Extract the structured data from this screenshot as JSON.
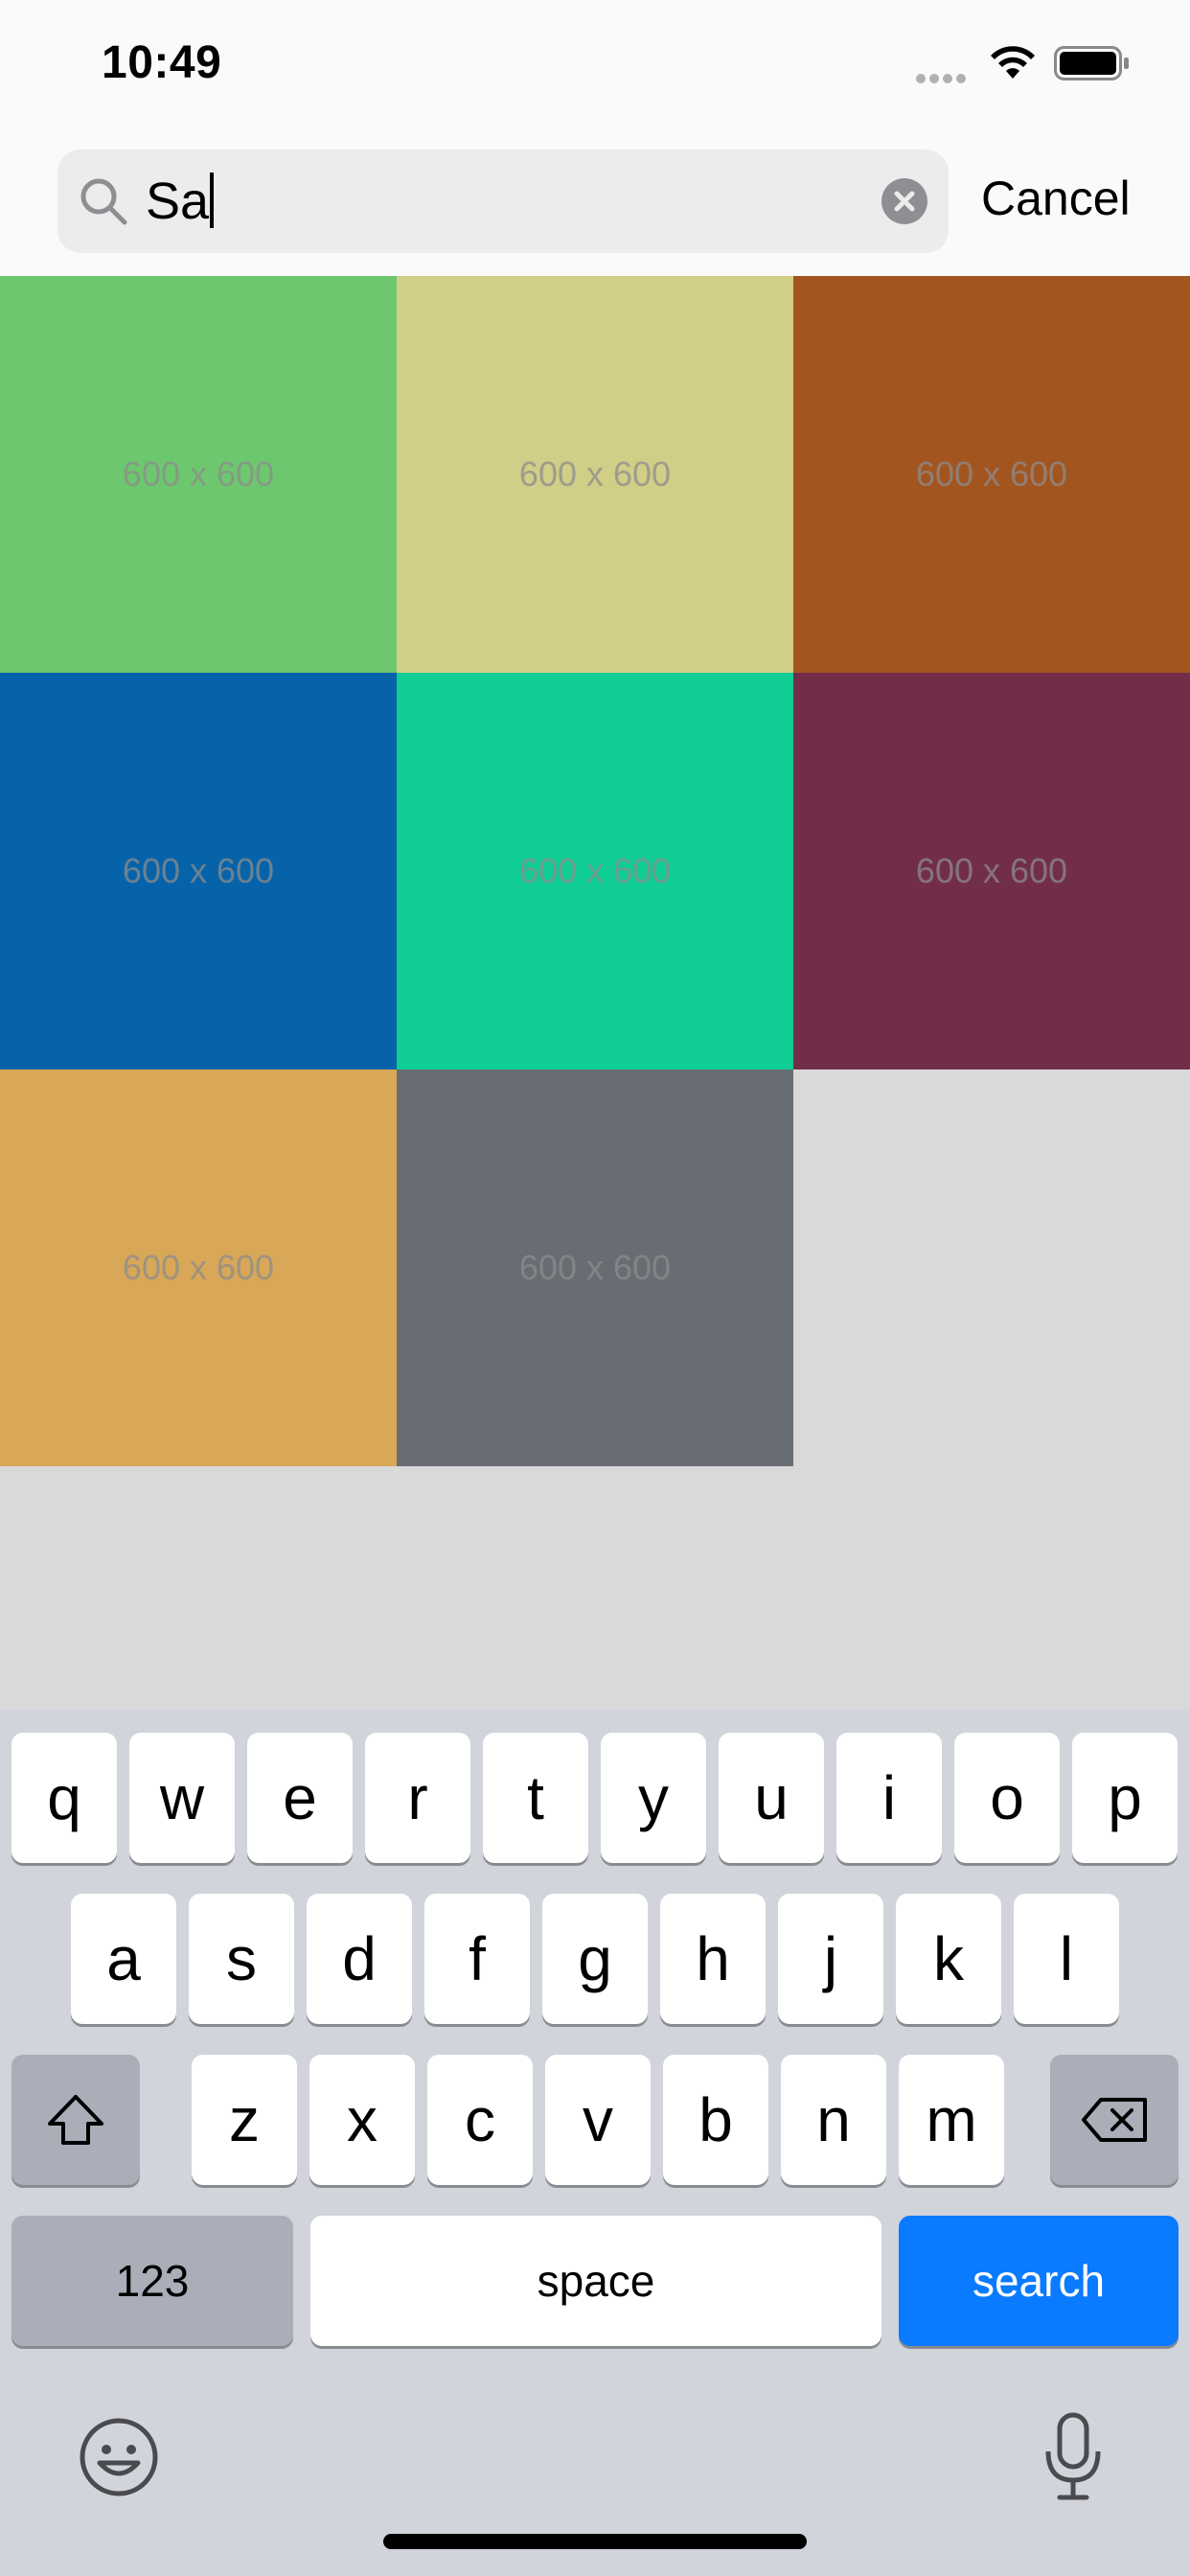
{
  "status_bar": {
    "time": "10:49"
  },
  "search": {
    "query": "Sa",
    "cancel_label": "Cancel"
  },
  "grid": {
    "tiles": [
      {
        "label": "600 x 600",
        "color": "#6dc76e"
      },
      {
        "label": "600 x 600",
        "color": "#d1ce87"
      },
      {
        "label": "600 x 600",
        "color": "#a35520"
      },
      {
        "label": "600 x 600",
        "color": "#0763a9"
      },
      {
        "label": "600 x 600",
        "color": "#10cc95"
      },
      {
        "label": "600 x 600",
        "color": "#722e48"
      },
      {
        "label": "600 x 600",
        "color": "#d8a757"
      },
      {
        "label": "600 x 600",
        "color": "#686d74"
      }
    ]
  },
  "keyboard": {
    "row1": [
      "q",
      "w",
      "e",
      "r",
      "t",
      "y",
      "u",
      "i",
      "o",
      "p"
    ],
    "row2": [
      "a",
      "s",
      "d",
      "f",
      "g",
      "h",
      "j",
      "k",
      "l"
    ],
    "row3": [
      "z",
      "x",
      "c",
      "v",
      "b",
      "n",
      "m"
    ],
    "numbers_label": "123",
    "space_label": "space",
    "search_label": "search",
    "accent_color": "#0a7aff"
  }
}
